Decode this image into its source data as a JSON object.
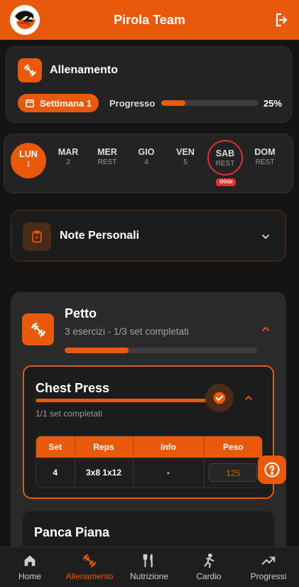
{
  "header": {
    "title": "Pirola Team"
  },
  "training": {
    "title": "Allenamento",
    "week_label": "Settimana 1",
    "progress_label": "Progresso",
    "progress_value": 0.25,
    "progress_text": "25%"
  },
  "days": [
    {
      "name": "LUN",
      "sub": "1",
      "state": "active"
    },
    {
      "name": "MAR",
      "sub": "2",
      "state": "normal"
    },
    {
      "name": "MER",
      "sub": "REST",
      "state": "normal"
    },
    {
      "name": "GIO",
      "sub": "4",
      "state": "normal"
    },
    {
      "name": "VEN",
      "sub": "5",
      "state": "normal"
    },
    {
      "name": "SAB",
      "sub": "REST",
      "state": "today"
    },
    {
      "name": "DOM",
      "sub": "REST",
      "state": "normal"
    }
  ],
  "today_badge": "OGGI",
  "notes": {
    "title": "Note Personali"
  },
  "group": {
    "title": "Petto",
    "subtitle": "3 esercizi - 1/3 set completati",
    "progress_value": 0.333
  },
  "exercise": {
    "title": "Chest Press",
    "progress_value": 1.0,
    "status": "1/1 set completati",
    "columns": [
      "Set",
      "Reps",
      "Info",
      "Peso"
    ],
    "rows": [
      {
        "set": "4",
        "reps": "3x8 1x12",
        "info": "-",
        "peso": "125"
      }
    ]
  },
  "next_exercise": {
    "title": "Panca Piana"
  },
  "nav": [
    {
      "label": "Home",
      "icon": "home-icon"
    },
    {
      "label": "Allenamento",
      "icon": "dumbbell-icon",
      "active": true
    },
    {
      "label": "Nutrizione",
      "icon": "fork-knife-icon"
    },
    {
      "label": "Cardio",
      "icon": "running-icon"
    },
    {
      "label": "Progressi",
      "icon": "trending-up-icon"
    }
  ],
  "colors": {
    "accent": "#e8590c",
    "today": "#e03131",
    "background": "#141414",
    "card": "#232323"
  }
}
